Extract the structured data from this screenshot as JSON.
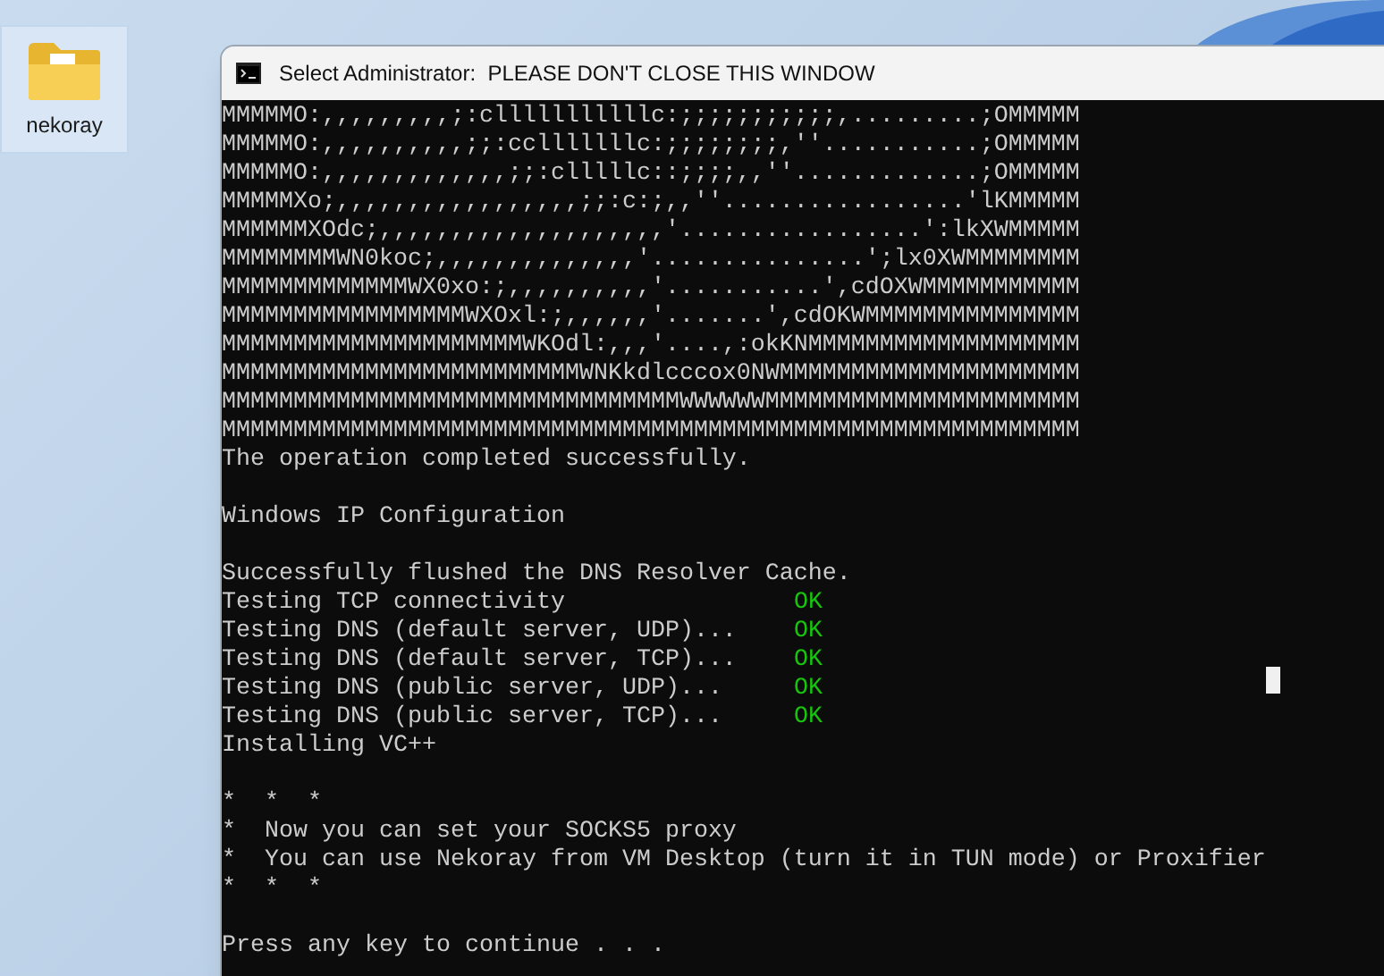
{
  "desktop_icons": [
    {
      "label": "nekoray",
      "selected": true
    }
  ],
  "window": {
    "title": "Select Administrator:  PLEASE DON'T CLOSE THIS WINDOW"
  },
  "console": {
    "cursor": true,
    "lines": [
      {
        "kind": "art",
        "text": "MMMMMO:,,,,,,,,,;:clllllllllllc:;;;;;;;;;;;,.........;OMMMMM"
      },
      {
        "kind": "art",
        "text": "MMMMMO:,,,,,,,,,,;;:cclllllllc:;;;;;;;;,''...........;OMMMMM"
      },
      {
        "kind": "art",
        "text": "MMMMMO:,,,,,,,,,,,,,;;:clllllc::;;;;,,''.............;OMMMMM"
      },
      {
        "kind": "art",
        "text": "MMMMMXo;,,,,,,,,,,,,,,,,,;;:c:;,,''.................'lKMMMMM"
      },
      {
        "kind": "art",
        "text": "MMMMMMXOdc;,,,,,,,,,,,,,,,,,,,,'.................':lkXWMMMMM"
      },
      {
        "kind": "art",
        "text": "MMMMMMMMWN0koc;,,,,,,,,,,,,,,'...............';lx0XWMMMMMMMM"
      },
      {
        "kind": "art",
        "text": "MMMMMMMMMMMMMWX0xo:;,,,,,,,,,,'...........',cdOXWMMMMMMMMMMM"
      },
      {
        "kind": "art",
        "text": "MMMMMMMMMMMMMMMMMWXOxl:;,,,,,,'.......',cdOKWMMMMMMMMMMMMMMM"
      },
      {
        "kind": "art",
        "text": "MMMMMMMMMMMMMMMMMMMMMWKOdl:,,,'....,:okKNMMMMMMMMMMMMMMMMMMM"
      },
      {
        "kind": "art",
        "text": "MMMMMMMMMMMMMMMMMMMMMMMMMWNKkdlcccox0NWMMMMMMMMMMMMMMMMMMMMM"
      },
      {
        "kind": "art",
        "text": "MMMMMMMMMMMMMMMMMMMMMMMMMMMMMMMMWWWWWWMMMMMMMMMMMMMMMMMMMMMM"
      },
      {
        "kind": "art",
        "text": "MMMMMMMMMMMMMMMMMMMMMMMMMMMMMMMMMMMMMMMMMMMMMMMMMMMMMMMMMMMM"
      },
      {
        "kind": "text",
        "text": "The operation completed successfully."
      },
      {
        "kind": "blank"
      },
      {
        "kind": "text",
        "text": "Windows IP Configuration"
      },
      {
        "kind": "blank"
      },
      {
        "kind": "text",
        "text": "Successfully flushed the DNS Resolver Cache."
      },
      {
        "kind": "test",
        "text": "Testing TCP connectivity",
        "result": "OK"
      },
      {
        "kind": "test",
        "text": "Testing DNS (default server, UDP)...",
        "result": "OK"
      },
      {
        "kind": "test",
        "text": "Testing DNS (default server, TCP)...",
        "result": "OK"
      },
      {
        "kind": "test",
        "text": "Testing DNS (public server, UDP)...",
        "result": "OK"
      },
      {
        "kind": "test",
        "text": "Testing DNS (public server, TCP)...",
        "result": "OK"
      },
      {
        "kind": "text",
        "text": "Installing VC++"
      },
      {
        "kind": "blank"
      },
      {
        "kind": "text",
        "text": "*  *  *"
      },
      {
        "kind": "text",
        "text": "*  Now you can set your SOCKS5 proxy"
      },
      {
        "kind": "text",
        "text": "*  You can use Nekoray from VM Desktop (turn it in TUN mode) or Proxifier"
      },
      {
        "kind": "text",
        "text": "*  *  *"
      },
      {
        "kind": "blank"
      },
      {
        "kind": "text",
        "text": "Press any key to continue . . ."
      }
    ]
  }
}
